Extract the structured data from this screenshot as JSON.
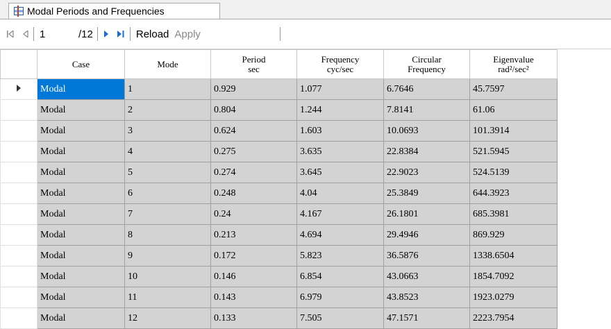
{
  "tab": {
    "title": "Modal Periods and Frequencies"
  },
  "toolbar": {
    "record_value": "1",
    "record_total": "/12",
    "reload_label": "Reload",
    "apply_label": "Apply"
  },
  "table": {
    "headers": [
      {
        "line1": "Case",
        "line2": ""
      },
      {
        "line1": "Mode",
        "line2": ""
      },
      {
        "line1": "Period",
        "line2": "sec"
      },
      {
        "line1": "Frequency",
        "line2": "cyc/sec"
      },
      {
        "line1": "Circular",
        "line2": "Frequency"
      },
      {
        "line1": "Eigenvalue",
        "line2": "rad²/sec²"
      }
    ],
    "rows": [
      [
        "Modal",
        "1",
        "0.929",
        "1.077",
        "6.7646",
        "45.7597"
      ],
      [
        "Modal",
        "2",
        "0.804",
        "1.244",
        "7.8141",
        "61.06"
      ],
      [
        "Modal",
        "3",
        "0.624",
        "1.603",
        "10.0693",
        "101.3914"
      ],
      [
        "Modal",
        "4",
        "0.275",
        "3.635",
        "22.8384",
        "521.5945"
      ],
      [
        "Modal",
        "5",
        "0.274",
        "3.645",
        "22.9023",
        "524.5139"
      ],
      [
        "Modal",
        "6",
        "0.248",
        "4.04",
        "25.3849",
        "644.3923"
      ],
      [
        "Modal",
        "7",
        "0.24",
        "4.167",
        "26.1801",
        "685.3981"
      ],
      [
        "Modal",
        "8",
        "0.213",
        "4.694",
        "29.4946",
        "869.929"
      ],
      [
        "Modal",
        "9",
        "0.172",
        "5.823",
        "36.5876",
        "1338.6504"
      ],
      [
        "Modal",
        "10",
        "0.146",
        "6.854",
        "43.0663",
        "1854.7092"
      ],
      [
        "Modal",
        "11",
        "0.143",
        "6.979",
        "43.8523",
        "1923.0279"
      ],
      [
        "Modal",
        "12",
        "0.133",
        "7.505",
        "47.1571",
        "2223.7954"
      ]
    ]
  }
}
